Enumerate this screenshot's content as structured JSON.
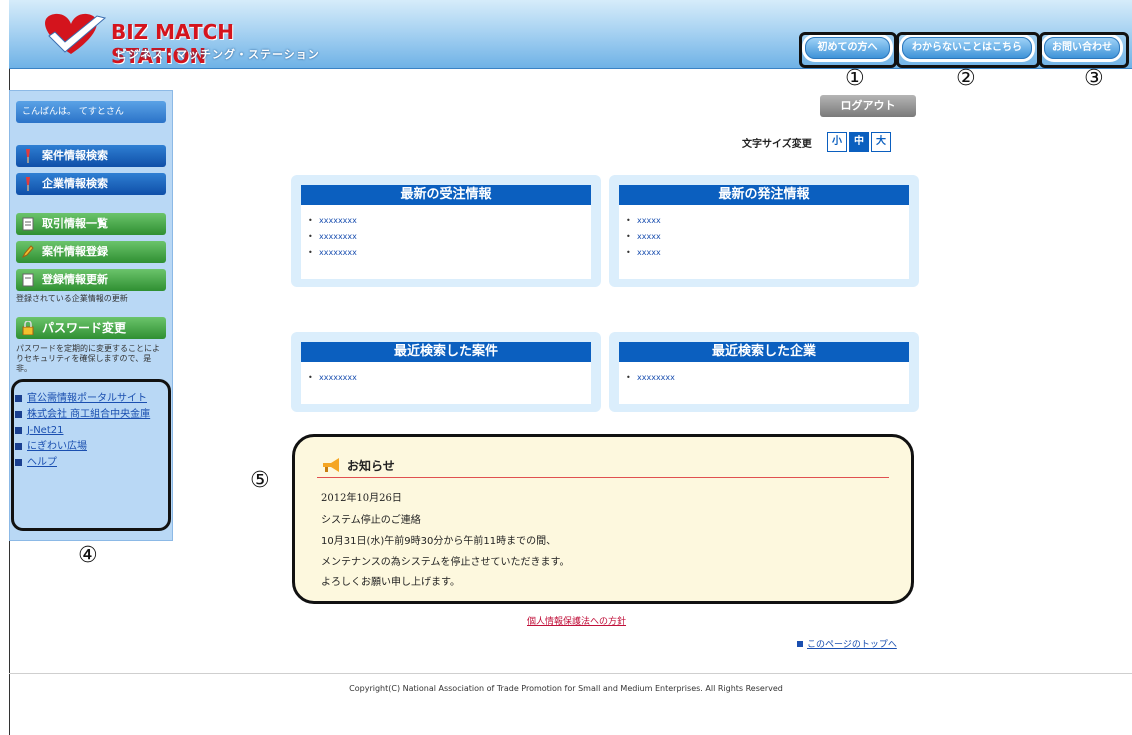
{
  "header": {
    "logo_title": "BIZ MATCH STATION",
    "logo_subtitle": "ビジネス・マッチング・ステーション",
    "buttons": [
      "初めての方へ",
      "わからないことはこちら",
      "お問い合わせ"
    ]
  },
  "annotations": [
    "①",
    "②",
    "③",
    "④",
    "⑤"
  ],
  "sidebar": {
    "greeting": "こんばんは。 てすとさん",
    "buttons": [
      "案件情報検索",
      "企業情報検索",
      "取引情報一覧",
      "案件情報登録",
      "登録情報更新",
      "パスワード変更"
    ],
    "notes": {
      "update": "登録されている企業情報の更新",
      "password": "パスワードを定期的に変更することによりセキュリティを確保しますので、是非。"
    },
    "links": [
      "官公需情報ポータルサイト",
      "株式会社 商工組合中央金庫",
      "J-Net21",
      "にぎわい広場",
      "ヘルプ"
    ]
  },
  "logout_label": "ログアウト",
  "font_size": {
    "label": "文字サイズ変更",
    "options": [
      "小",
      "中",
      "大"
    ],
    "selected": "中"
  },
  "panels": {
    "received": {
      "title": "最新の受注情報",
      "items": [
        "xxxxxxxx",
        "xxxxxxxx",
        "xxxxxxxx"
      ]
    },
    "ordered": {
      "title": "最新の発注情報",
      "items": [
        "xxxxx",
        "xxxxx",
        "xxxxx"
      ]
    },
    "recent_cases": {
      "title": "最近検索した案件",
      "items": [
        "xxxxxxxx"
      ]
    },
    "recent_companies": {
      "title": "最近検索した企業",
      "items": [
        "xxxxxxxx"
      ]
    }
  },
  "notice": {
    "title": "お知らせ",
    "lines": [
      "2012年10月26日",
      "システム停止のご連絡",
      "10月31日(水)午前9時30分から午前11時までの間、",
      "メンテナンスの為システムを停止させていただきます。",
      "よろしくお願い申し上げます。"
    ]
  },
  "footer": {
    "privacy_link": "個人情報保護法への方針",
    "top_link": "このページのトップへ",
    "copyright": "Copyright(C) National Association of Trade Promotion for Small and Medium Enterprises. All Rights Reserved"
  },
  "colors": {
    "header_blue": "#6fb2e6",
    "brand_red": "#d4141d",
    "panel_blue": "#0b5fbf",
    "sidebar_bg": "#b9d8f5"
  }
}
